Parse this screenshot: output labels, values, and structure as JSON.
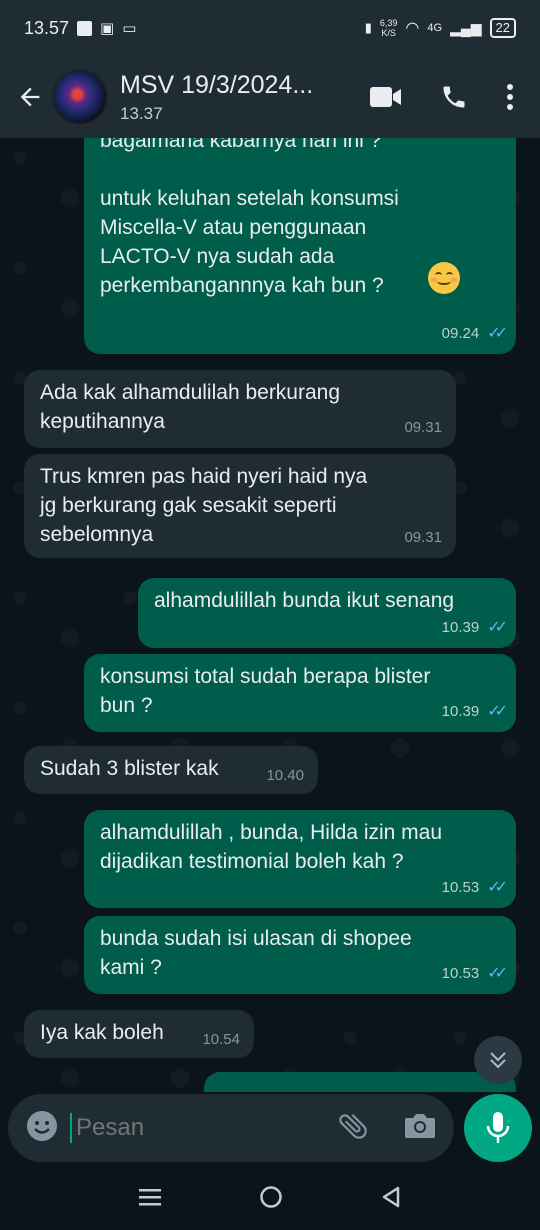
{
  "status_bar": {
    "time": "13.57",
    "speed_value": "6,39",
    "speed_unit": "K/S",
    "network": "4G",
    "battery": "22"
  },
  "header": {
    "title": "MSV 19/3/2024...",
    "subtitle": "13.37"
  },
  "messages": [
    {
      "dir": "out",
      "text": "bagaimana kabarnya hari ini ?\n\nuntuk keluhan setelah konsumsi\nMiscella-V atau penggunaan\nLACTO-V nya sudah ada\nperkembangannnya kah bun ?",
      "time": "09.24",
      "emoji": "smiling-face"
    },
    {
      "dir": "in",
      "text": "Ada kak alhamdulilah berkurang\nkeputihannya",
      "time": "09.31"
    },
    {
      "dir": "in",
      "text": "Trus kmren pas haid nyeri haid nya\njg berkurang gak sesakit seperti\nsebelomnya",
      "time": "09.31"
    },
    {
      "dir": "out",
      "text": "alhamdulillah bunda ikut senang",
      "time": "10.39"
    },
    {
      "dir": "out",
      "text": "konsumsi total sudah berapa blister\nbun ?",
      "time": "10.39"
    },
    {
      "dir": "in",
      "text": "Sudah 3 blister kak",
      "time": "10.40"
    },
    {
      "dir": "out",
      "text": "alhamdulillah , bunda, Hilda izin mau\ndijadikan testimonial boleh kah ?",
      "time": "10.53"
    },
    {
      "dir": "out",
      "text": "bunda sudah isi ulasan di shopee\nkami ?",
      "time": "10.53"
    },
    {
      "dir": "in",
      "text": "Iya kak boleh",
      "time": "10.54"
    }
  ],
  "input": {
    "placeholder": "Pesan"
  },
  "colors": {
    "outgoing_bubble": "#005c4b",
    "incoming_bubble": "#202c33",
    "accent": "#00a884",
    "read_ticks": "#53bdeb"
  }
}
